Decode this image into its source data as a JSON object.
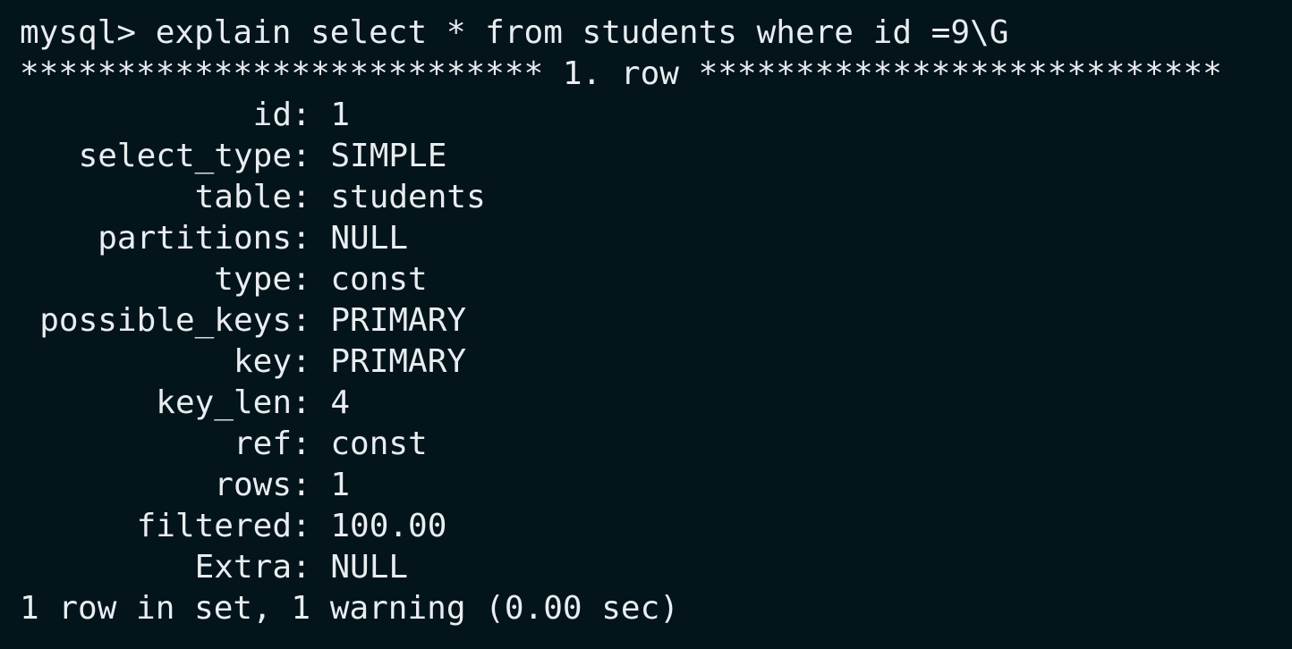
{
  "terminal": {
    "prompt": "mysql> ",
    "command": "explain select * from students where id =9\\G",
    "row_header": "*************************** 1. row ***************************",
    "fields": [
      {
        "label": "id",
        "value": "1"
      },
      {
        "label": "select_type",
        "value": "SIMPLE"
      },
      {
        "label": "table",
        "value": "students"
      },
      {
        "label": "partitions",
        "value": "NULL"
      },
      {
        "label": "type",
        "value": "const"
      },
      {
        "label": "possible_keys",
        "value": "PRIMARY"
      },
      {
        "label": "key",
        "value": "PRIMARY"
      },
      {
        "label": "key_len",
        "value": "4"
      },
      {
        "label": "ref",
        "value": "const"
      },
      {
        "label": "rows",
        "value": "1"
      },
      {
        "label": "filtered",
        "value": "100.00"
      },
      {
        "label": "Extra",
        "value": "NULL"
      }
    ],
    "footer": "1 row in set, 1 warning (0.00 sec)",
    "colors": {
      "background": "#04141b",
      "foreground": "#e8edf0"
    }
  }
}
